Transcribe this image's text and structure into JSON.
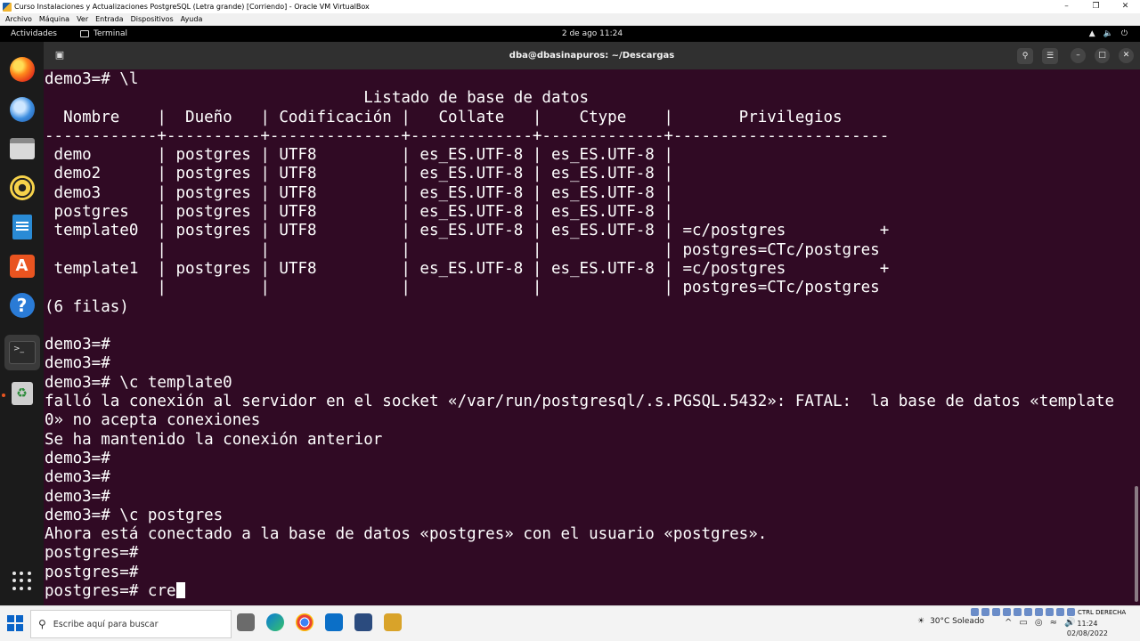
{
  "vbox": {
    "title": "Curso Instalaciones y Actualizaciones PostgreSQL (Letra grande) [Corriendo] - Oracle VM VirtualBox",
    "menu": [
      "Archivo",
      "Máquina",
      "Ver",
      "Entrada",
      "Dispositivos",
      "Ayuda"
    ],
    "host_key": "CTRL DERECHA"
  },
  "gnome": {
    "activities": "Actividades",
    "app_name": "Terminal",
    "clock": "2 de ago  11:24"
  },
  "terminal": {
    "title": "dba@dbasinapuros: ~/Descargas",
    "lines": [
      "demo3=# \\l",
      "                                  Listado de base de datos",
      "  Nombre    |  Dueño   | Codificación |   Collate   |    Ctype    |       Privilegios",
      "------------+----------+--------------+-------------+-------------+-----------------------",
      " demo       | postgres | UTF8         | es_ES.UTF-8 | es_ES.UTF-8 |",
      " demo2      | postgres | UTF8         | es_ES.UTF-8 | es_ES.UTF-8 |",
      " demo3      | postgres | UTF8         | es_ES.UTF-8 | es_ES.UTF-8 |",
      " postgres   | postgres | UTF8         | es_ES.UTF-8 | es_ES.UTF-8 |",
      " template0  | postgres | UTF8         | es_ES.UTF-8 | es_ES.UTF-8 | =c/postgres          +",
      "            |          |              |             |             | postgres=CTc/postgres",
      " template1  | postgres | UTF8         | es_ES.UTF-8 | es_ES.UTF-8 | =c/postgres          +",
      "            |          |              |             |             | postgres=CTc/postgres",
      "(6 filas)",
      "",
      "demo3=#",
      "demo3=#",
      "demo3=# \\c template0",
      "falló la conexión al servidor en el socket «/var/run/postgresql/.s.PGSQL.5432»: FATAL:  la base de datos «template",
      "0» no acepta conexiones",
      "Se ha mantenido la conexión anterior",
      "demo3=#",
      "demo3=#",
      "demo3=#",
      "demo3=# \\c postgres",
      "Ahora está conectado a la base de datos «postgres» con el usuario «postgres».",
      "postgres=#",
      "postgres=#"
    ],
    "current_prompt": "postgres=# ",
    "current_input": "cre"
  },
  "taskbar": {
    "search_placeholder": "Escribe aquí para buscar",
    "weather": "30°C  Soleado",
    "time": "11:24",
    "date": "02/08/2022"
  },
  "colors": {
    "terminal_bg": "#300a24",
    "ubuntu_orange": "#e95420",
    "header_bg": "#303030"
  }
}
